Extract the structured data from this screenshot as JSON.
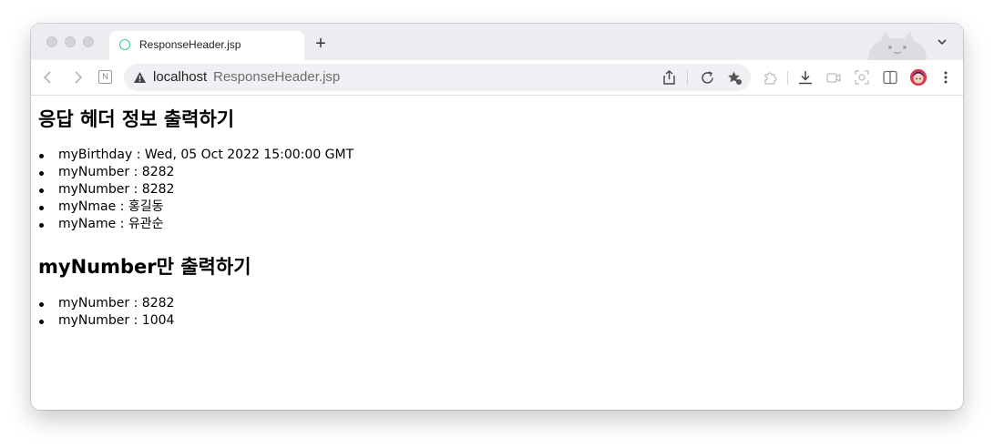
{
  "browser": {
    "tab": {
      "title": "ResponseHeader.jsp"
    },
    "new_tab_symbol": "+",
    "address": {
      "host": "localhost",
      "path": "ResponseHeader.jsp"
    },
    "notion_icon_letter": "N",
    "favicon_color": "#37c7a0",
    "avatar_color": "#d93a52"
  },
  "page": {
    "heading1": "응답 헤더 정보 출력하기",
    "headers": [
      {
        "name": "myBirthday",
        "sep": " : ",
        "value": "Wed, 05 Oct 2022 15:00:00 GMT"
      },
      {
        "name": "myNumber",
        "sep": " : ",
        "value": "8282"
      },
      {
        "name": "myNumber",
        "sep": " : ",
        "value": "8282"
      },
      {
        "name": "myNmae",
        "sep": " : ",
        "value": "홍길동"
      },
      {
        "name": "myName",
        "sep": " : ",
        "value": "유관순"
      }
    ],
    "heading2": "myNumber만 출력하기",
    "number_headers": [
      {
        "name": "myNumber",
        "sep": " : ",
        "value": "8282"
      },
      {
        "name": "myNumber",
        "sep": " : ",
        "value": "1004"
      }
    ]
  }
}
